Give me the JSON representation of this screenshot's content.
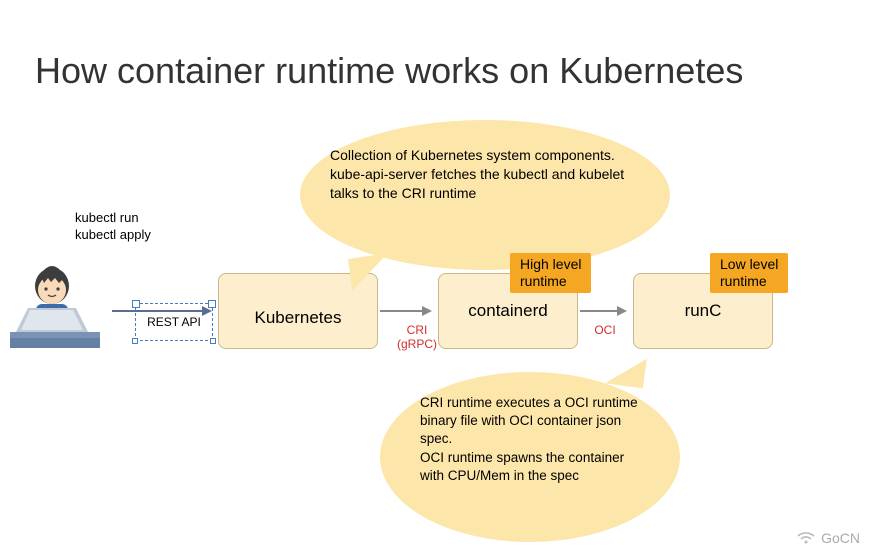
{
  "title": "How container runtime works on Kubernetes",
  "user_commands": {
    "line1": "kubectl run",
    "line2": "kubectl apply"
  },
  "rest_api_label": "REST API",
  "nodes": {
    "kubernetes": "Kubernetes",
    "containerd": "containerd",
    "runc": "runC"
  },
  "tags": {
    "high": "High level\nruntime",
    "low": "Low level\nruntime"
  },
  "links": {
    "cri": "CRI\n(gRPC)",
    "oci": "OCI"
  },
  "bubble_top": "Collection of Kubernetes system components.\nkube-api-server fetches the kubectl and kubelet talks to the CRI runtime",
  "bubble_bottom": "CRI runtime executes a OCI runtime binary file with OCI container json spec.\nOCI runtime spawns the container with CPU/Mem in the spec",
  "watermark": "GoCN",
  "colors": {
    "bubble": "#fce6a9",
    "node": "#fdefcd",
    "tag": "#f5a623",
    "link_label": "#d32f2f"
  }
}
